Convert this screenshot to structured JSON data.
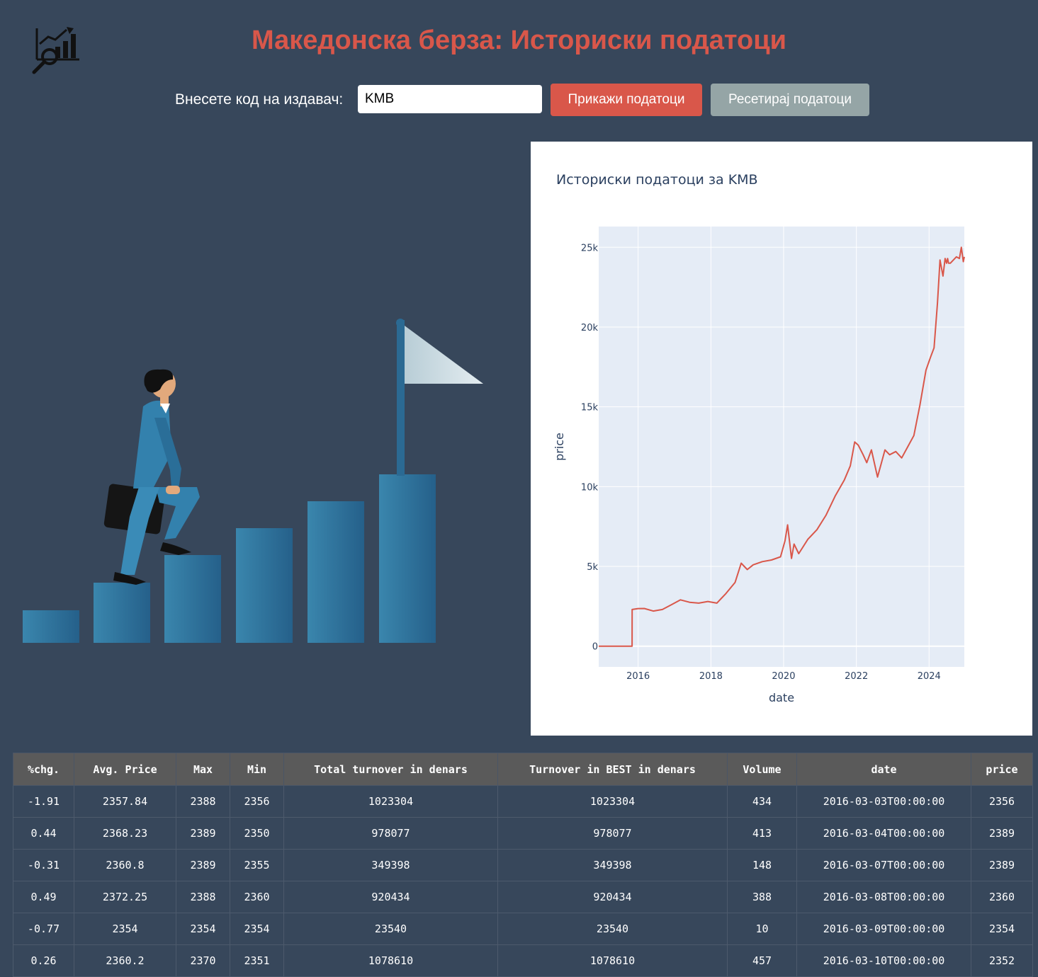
{
  "header": {
    "title": "Македонска берза: Историски податоци"
  },
  "controls": {
    "issuer_label": "Внесете код на издавач:",
    "issuer_value": "KMB",
    "show_button": "Прикажи податоци",
    "reset_button": "Ресетирај податоци"
  },
  "colors": {
    "background": "#37475b",
    "accent": "#d9574a",
    "reset": "#95a5a6",
    "plot_bg": "#e5ecf6",
    "line": "#d9574a"
  },
  "chart_data": {
    "type": "line",
    "title": "Историски податоци за KMB",
    "xlabel": "date",
    "ylabel": "price",
    "x_ticks": [
      "2016",
      "2018",
      "2020",
      "2022",
      "2024"
    ],
    "y_ticks": [
      "0",
      "5k",
      "10k",
      "15k",
      "20k",
      "25k"
    ],
    "xlim": [
      "2014-12-01",
      "2024-12-20"
    ],
    "ylim": [
      -1300,
      26300
    ],
    "grid": true,
    "series": [
      {
        "x": [
          "2014-12-01",
          "2015-11-01",
          "2015-11-02",
          "2016-01-01",
          "2016-03-03",
          "2016-06-01",
          "2016-09-01",
          "2016-12-01",
          "2017-03-01",
          "2017-06-01",
          "2017-09-01",
          "2017-12-01",
          "2018-03-01",
          "2018-06-01",
          "2018-09-01",
          "2018-11-01",
          "2019-01-01",
          "2019-03-01",
          "2019-06-01",
          "2019-09-01",
          "2019-12-01",
          "2020-01-15",
          "2020-02-10",
          "2020-03-20",
          "2020-04-15",
          "2020-06-01",
          "2020-09-01",
          "2020-12-01",
          "2021-03-01",
          "2021-06-01",
          "2021-09-01",
          "2021-11-01",
          "2021-12-15",
          "2022-01-20",
          "2022-03-10",
          "2022-04-15",
          "2022-06-01",
          "2022-08-01",
          "2022-09-10",
          "2022-10-15",
          "2022-12-01",
          "2023-02-01",
          "2023-04-01",
          "2023-06-01",
          "2023-08-01",
          "2023-10-01",
          "2023-12-01",
          "2024-01-15",
          "2024-02-20",
          "2024-03-25",
          "2024-04-20",
          "2024-05-20",
          "2024-06-10",
          "2024-06-25",
          "2024-07-05",
          "2024-07-15",
          "2024-08-01",
          "2024-09-01",
          "2024-10-01",
          "2024-11-01",
          "2024-11-20",
          "2024-12-10",
          "2024-12-20"
        ],
        "values": [
          0,
          0,
          2300,
          2356,
          2360,
          2200,
          2300,
          2600,
          2900,
          2750,
          2700,
          2800,
          2700,
          3300,
          4000,
          5200,
          4800,
          5100,
          5300,
          5400,
          5600,
          6600,
          7600,
          5500,
          6400,
          5800,
          6700,
          7300,
          8200,
          9400,
          10400,
          11300,
          12800,
          12600,
          12000,
          11500,
          12300,
          10600,
          11500,
          12300,
          12000,
          12200,
          11800,
          12500,
          13200,
          15100,
          17300,
          18100,
          18700,
          21500,
          24200,
          23200,
          24300,
          24000,
          24300,
          24000,
          24000,
          24200,
          24400,
          24300,
          25000,
          24100,
          24400
        ]
      }
    ]
  }
}
